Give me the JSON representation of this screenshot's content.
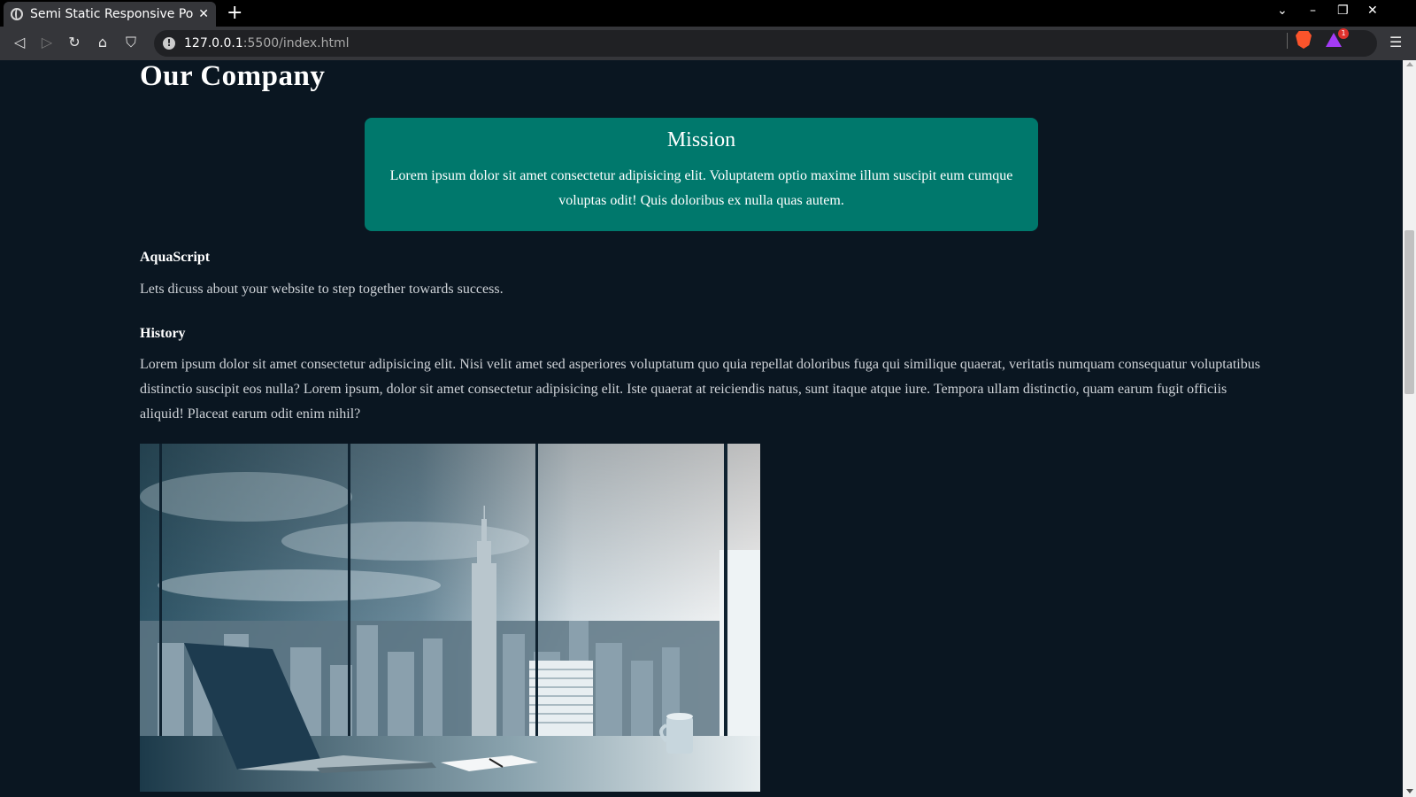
{
  "browser": {
    "tab_title": "Semi Static Responsive Po",
    "tab_close": "✕",
    "new_tab": "+",
    "url_host": "127.0.0.1",
    "url_path": ":5500/index.html",
    "rewards_count": "1",
    "window_controls": [
      "⌄",
      "–",
      "❐",
      "✕"
    ]
  },
  "page": {
    "title": "Our Company",
    "mission": {
      "title": "Mission",
      "text": "Lorem ipsum dolor sit amet consectetur adipisicing elit. Voluptatem optio maxime illum suscipit eum cumque voluptas odit! Quis doloribus ex nulla quas autem."
    },
    "aquascript": {
      "heading": "AquaScript",
      "text": "Lets dicuss about your website to step together towards success."
    },
    "history": {
      "heading": "History",
      "text": "Lorem ipsum dolor sit amet consectetur adipisicing elit. Nisi velit amet sed asperiores voluptatum quo quia repellat doloribus fuga qui similique quaerat, veritatis numquam consequatur voluptatibus distinctio suscipit eos nulla? Lorem ipsum, dolor sit amet consectetur adipisicing elit. Iste quaerat at reiciendis natus, sunt itaque atque iure. Tempora ullam distinctio, quam earum fugit officiis aliquid! Placeat earum odit enim nihil?"
    }
  },
  "colors": {
    "page_background": "#0a1621",
    "mission_background": "#00786c"
  }
}
